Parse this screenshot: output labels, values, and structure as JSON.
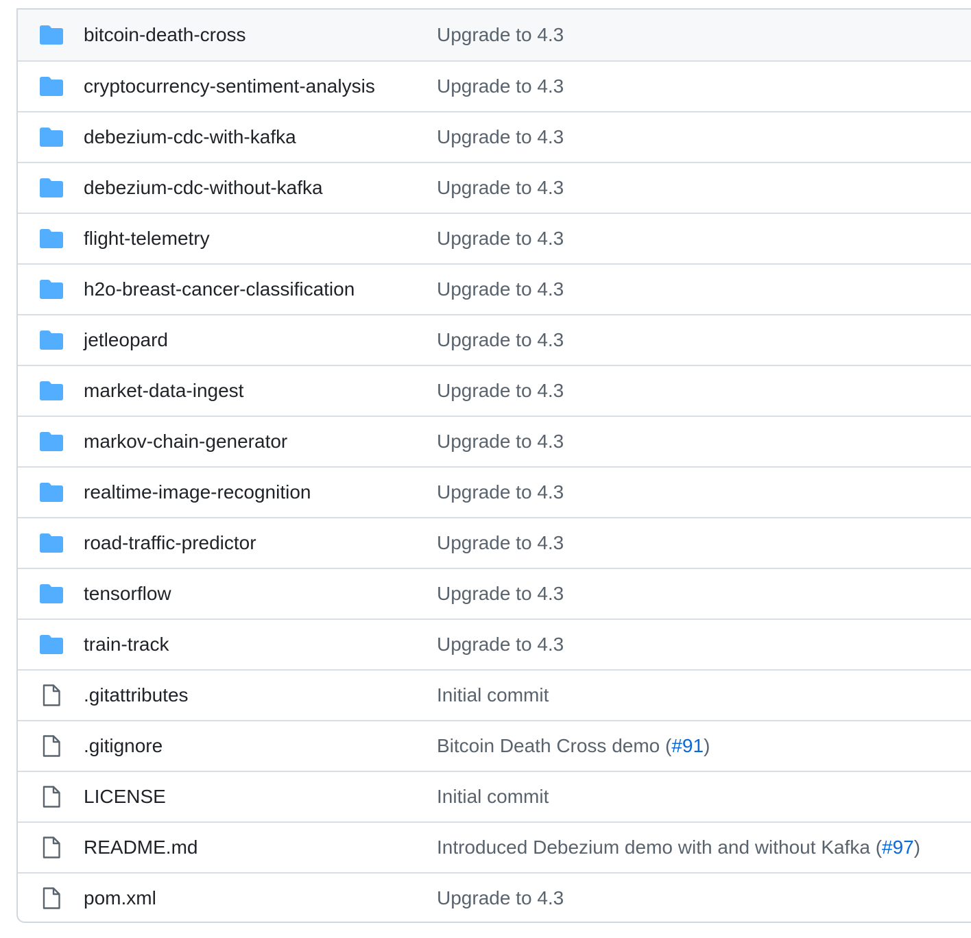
{
  "colors": {
    "folder_icon": "#54aeff",
    "file_icon": "#59636e",
    "link": "#0969da",
    "name_text": "#1f2328",
    "message_text": "#59636e",
    "border": "#d0d7de"
  },
  "entries": [
    {
      "type": "folder",
      "icon": "folder-icon",
      "name": "bitcoin-death-cross",
      "message": "Upgrade to 4.3"
    },
    {
      "type": "folder",
      "icon": "folder-icon",
      "name": "cryptocurrency-sentiment-analysis",
      "message": "Upgrade to 4.3"
    },
    {
      "type": "folder",
      "icon": "folder-icon",
      "name": "debezium-cdc-with-kafka",
      "message": "Upgrade to 4.3"
    },
    {
      "type": "folder",
      "icon": "folder-icon",
      "name": "debezium-cdc-without-kafka",
      "message": "Upgrade to 4.3"
    },
    {
      "type": "folder",
      "icon": "folder-icon",
      "name": "flight-telemetry",
      "message": "Upgrade to 4.3"
    },
    {
      "type": "folder",
      "icon": "folder-icon",
      "name": "h2o-breast-cancer-classification",
      "message": "Upgrade to 4.3"
    },
    {
      "type": "folder",
      "icon": "folder-icon",
      "name": "jetleopard",
      "message": "Upgrade to 4.3"
    },
    {
      "type": "folder",
      "icon": "folder-icon",
      "name": "market-data-ingest",
      "message": "Upgrade to 4.3"
    },
    {
      "type": "folder",
      "icon": "folder-icon",
      "name": "markov-chain-generator",
      "message": "Upgrade to 4.3"
    },
    {
      "type": "folder",
      "icon": "folder-icon",
      "name": "realtime-image-recognition",
      "message": "Upgrade to 4.3"
    },
    {
      "type": "folder",
      "icon": "folder-icon",
      "name": "road-traffic-predictor",
      "message": "Upgrade to 4.3"
    },
    {
      "type": "folder",
      "icon": "folder-icon",
      "name": "tensorflow",
      "message": "Upgrade to 4.3"
    },
    {
      "type": "folder",
      "icon": "folder-icon",
      "name": "train-track",
      "message": "Upgrade to 4.3"
    },
    {
      "type": "file",
      "icon": "file-icon",
      "name": ".gitattributes",
      "message": "Initial commit"
    },
    {
      "type": "file",
      "icon": "file-icon",
      "name": ".gitignore",
      "message": "Bitcoin Death Cross demo (",
      "pr": "#91",
      "message_after": ")"
    },
    {
      "type": "file",
      "icon": "file-icon",
      "name": "LICENSE",
      "message": "Initial commit"
    },
    {
      "type": "file",
      "icon": "file-icon",
      "name": "README.md",
      "message": "Introduced Debezium demo with and without Kafka (",
      "pr": "#97",
      "message_after": ")"
    },
    {
      "type": "file",
      "icon": "file-icon",
      "name": "pom.xml",
      "message": "Upgrade to 4.3"
    }
  ]
}
